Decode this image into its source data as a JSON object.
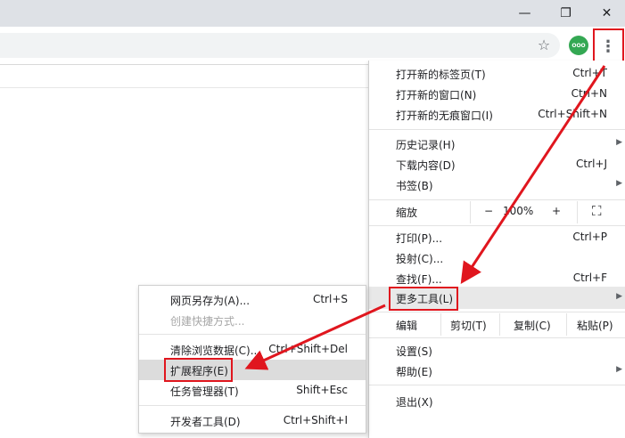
{
  "window": {
    "minimize_glyph": "—",
    "restore_glyph": "❐",
    "close_glyph": "✕"
  },
  "toolbar": {
    "star_glyph": "☆",
    "profile_glyph": "OOO",
    "menu_glyph": "⋮"
  },
  "main_menu": {
    "items": [
      {
        "label": "打开新的标签页(T)",
        "shortcut": "Ctrl+T"
      },
      {
        "label": "打开新的窗口(N)",
        "shortcut": "Ctrl+N"
      },
      {
        "label": "打开新的无痕窗口(I)",
        "shortcut": "Ctrl+Shift+N"
      },
      {
        "label": "历史记录(H)",
        "shortcut": ""
      },
      {
        "label": "下载内容(D)",
        "shortcut": "Ctrl+J"
      },
      {
        "label": "书签(B)",
        "shortcut": ""
      },
      {
        "label": "打印(P)...",
        "shortcut": "Ctrl+P"
      },
      {
        "label": "投射(C)...",
        "shortcut": ""
      },
      {
        "label": "查找(F)...",
        "shortcut": "Ctrl+F"
      },
      {
        "label": "更多工具(L)",
        "shortcut": ""
      },
      {
        "label": "设置(S)",
        "shortcut": ""
      },
      {
        "label": "帮助(E)",
        "shortcut": ""
      },
      {
        "label": "退出(X)",
        "shortcut": ""
      }
    ],
    "zoom": {
      "label": "缩放",
      "minus": "−",
      "value": "100%",
      "plus": "+",
      "fullscreen": "⛶"
    },
    "edit": {
      "label": "编辑",
      "cut": "剪切(T)",
      "copy": "复制(C)",
      "paste": "粘贴(P)"
    },
    "arrow_glyph": "▶"
  },
  "more_tools_menu": {
    "items": [
      {
        "label": "网页另存为(A)...",
        "shortcut": "Ctrl+S"
      },
      {
        "label": "创建快捷方式...",
        "shortcut": ""
      },
      {
        "label": "清除浏览数据(C)...",
        "shortcut": "Ctrl+Shift+Del"
      },
      {
        "label": "扩展程序(E)",
        "shortcut": ""
      },
      {
        "label": "任务管理器(T)",
        "shortcut": "Shift+Esc"
      },
      {
        "label": "开发者工具(D)",
        "shortcut": "Ctrl+Shift+I"
      }
    ]
  },
  "colors": {
    "highlight": "#e0161e",
    "arrow": "#e0161e"
  }
}
